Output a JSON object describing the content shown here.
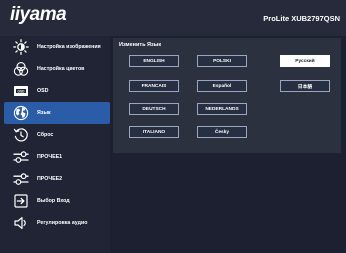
{
  "header": {
    "brand": "iiyama",
    "model": "ProLite XUB2797QSN"
  },
  "sidebar": {
    "items": [
      {
        "label": "Настройка изображения",
        "icon": "brightness-icon"
      },
      {
        "label": "Настройка цветов",
        "icon": "color-circles-icon"
      },
      {
        "label": "OSD",
        "icon": "osd-icon"
      },
      {
        "label": "Язык",
        "icon": "globe-icon",
        "active": true
      },
      {
        "label": "Сброс",
        "icon": "reset-icon"
      },
      {
        "label": "ПРОЧЕЕ1",
        "icon": "settings-sliders-icon"
      },
      {
        "label": "ПРОЧЕЕ2",
        "icon": "settings-sliders-icon"
      },
      {
        "label": "Выбор Вход",
        "icon": "input-select-icon"
      },
      {
        "label": "Регулировка аудио",
        "icon": "speaker-icon"
      }
    ]
  },
  "panel": {
    "title": "Изменить Язык",
    "options": [
      {
        "label": "ENGLISH"
      },
      {
        "label": "POLSKI"
      },
      {
        "label": "Русский",
        "selected": true
      },
      {
        "label": "FRANCAIS"
      },
      {
        "label": "Español"
      },
      {
        "label": "日本語"
      },
      {
        "label": "DEUTSCH"
      },
      {
        "label": "NEDERLANDS"
      },
      {
        "label": "ITALIANO"
      },
      {
        "label": "Česky"
      }
    ]
  },
  "colors": {
    "background": "#1c2030",
    "active": "#2a5ca8",
    "selected_option": "#ffffff"
  }
}
